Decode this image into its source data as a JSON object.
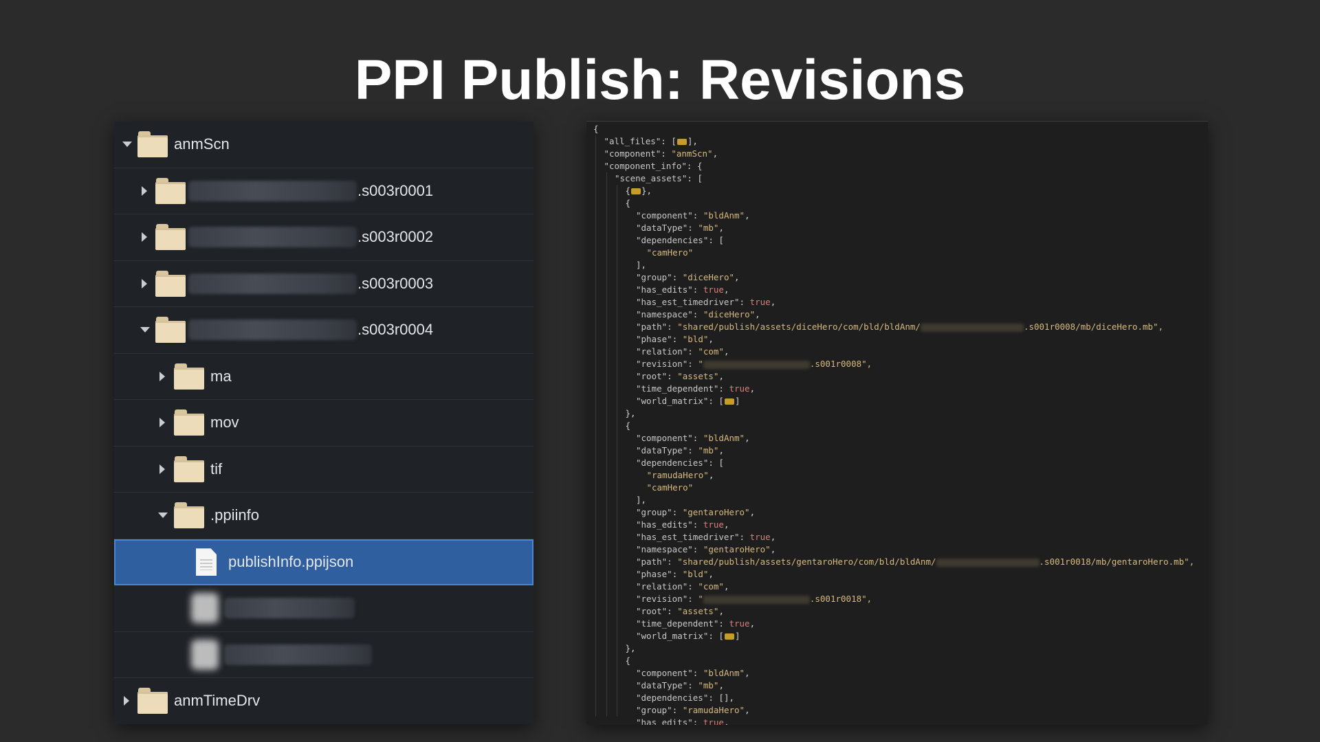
{
  "title": "PPI Publish: Revisions",
  "colors": {
    "background": "#2b2b2b",
    "panel": "#1f2227",
    "selection": "#2f5f9e",
    "folder": "#ecdcb9",
    "json_string": "#d7ba7d",
    "json_bool": "#e07a7a",
    "collapsed_marker": "#c69d2a"
  },
  "tree": {
    "rows": [
      {
        "label": "anmScn",
        "icon": "folder-icon",
        "expanded": true
      },
      {
        "label": ".s003r0001",
        "icon": "folder-icon",
        "expanded": false,
        "redacted_prefix": true
      },
      {
        "label": ".s003r0002",
        "icon": "folder-icon",
        "expanded": false,
        "redacted_prefix": true
      },
      {
        "label": ".s003r0003",
        "icon": "folder-icon",
        "expanded": false,
        "redacted_prefix": true
      },
      {
        "label": ".s003r0004",
        "icon": "folder-icon",
        "expanded": true,
        "redacted_prefix": true
      },
      {
        "label": "ma",
        "icon": "folder-icon",
        "expanded": false
      },
      {
        "label": "mov",
        "icon": "folder-icon",
        "expanded": false
      },
      {
        "label": "tif",
        "icon": "folder-icon",
        "expanded": false
      },
      {
        "label": ".ppiinfo",
        "icon": "folder-icon",
        "expanded": true
      },
      {
        "label": "publishInfo.ppijson",
        "icon": "file-icon",
        "selected": true
      },
      {
        "label": "",
        "icon": "redacted-file-icon",
        "redacted": true
      },
      {
        "label": "",
        "icon": "redacted-file-icon",
        "redacted": true
      },
      {
        "label": "anmTimeDrv",
        "icon": "folder-icon",
        "expanded": false
      }
    ]
  },
  "json": {
    "lines": [
      "{",
      "\"all_files\": [",
      "\"component\": \"anmScn\",",
      "\"component_info\": {",
      "\"scene_assets\": [",
      "{",
      "{",
      "\"component\": \"bldAnm\",",
      "\"dataType\": \"mb\",",
      "\"dependencies\": [",
      "\"camHero\"",
      "],",
      "\"group\": \"diceHero\",",
      "\"has_edits\": true,",
      "\"has_est_timedriver\": true,",
      "\"namespace\": \"diceHero\",",
      "\"path\": \"shared/publish/assets/diceHero/com/bld/bldAnm/",
      "\"phase\": \"bld\",",
      "\"relation\": \"com\",",
      "\"revision\": \"",
      "\"root\": \"assets\",",
      "\"time_dependent\": true,",
      "\"world_matrix\": [",
      "},",
      "{",
      "\"component\": \"bldAnm\",",
      "\"dataType\": \"mb\",",
      "\"dependencies\": [",
      "\"ramudaHero\",",
      "\"camHero\"",
      "],",
      "\"group\": \"gentaroHero\",",
      "\"has_edits\": true,",
      "\"has_est_timedriver\": true,",
      "\"namespace\": \"gentaroHero\",",
      "\"path\": \"shared/publish/assets/gentaroHero/com/bld/bldAnm/",
      "\"phase\": \"bld\",",
      "\"relation\": \"com\",",
      "\"revision\": \"",
      "\"root\": \"assets\",",
      "\"time_dependent\": true,",
      "\"world_matrix\": [",
      "},",
      "{",
      "\"component\": \"bldAnm\",",
      "\"dataType\": \"mb\",",
      "\"dependencies\": [],",
      "\"group\": \"ramudaHero\",",
      "\"has_edits\": true,"
    ],
    "suffixes": {
      "1": "],",
      "5": "},",
      "16": ".s001r0008/mb/diceHero.mb\",",
      "19": ".s001r0008\",",
      "22": "]",
      "35": ".s001r0018/mb/gentaroHero.mb\",",
      "38": ".s001r0018\",",
      "41": "]"
    }
  }
}
